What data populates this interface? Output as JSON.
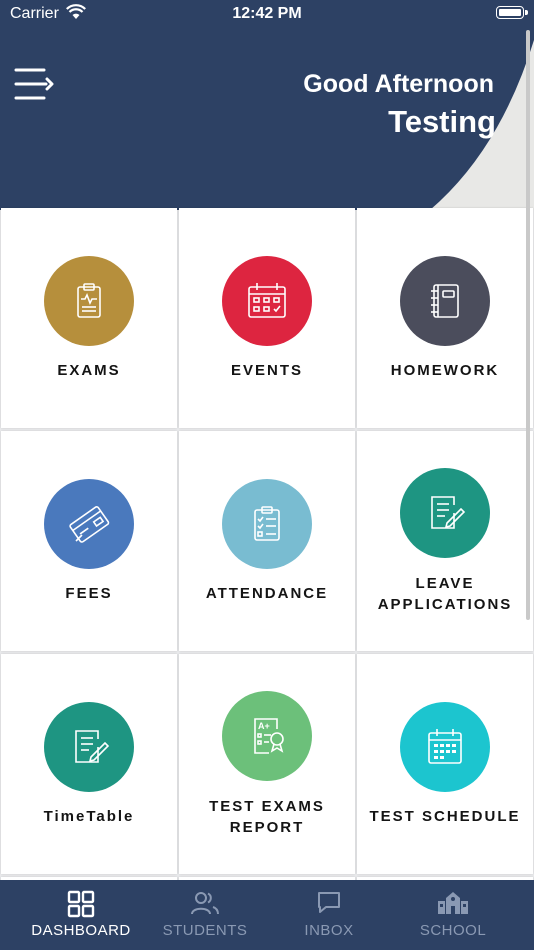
{
  "status_bar": {
    "carrier": "Carrier",
    "time": "12:42 PM"
  },
  "header": {
    "greeting": "Good Afternoon",
    "username": "Testing"
  },
  "tiles": [
    {
      "label": "EXAMS",
      "color": "#b68f3c",
      "icon": "clipboard-icon"
    },
    {
      "label": "EVENTS",
      "color": "#dd2540",
      "icon": "calendar-icon"
    },
    {
      "label": "HOMEWORK",
      "color": "#4b4d5c",
      "icon": "notebook-icon"
    },
    {
      "label": "FEES",
      "color": "#4a79bd",
      "icon": "credit-card-icon"
    },
    {
      "label": "ATTENDANCE",
      "color": "#79bcd1",
      "icon": "checklist-icon"
    },
    {
      "label_line1": "LEAVE",
      "label_line2": "APPLICATIONS",
      "color": "#1e9582",
      "icon": "edit-document-icon"
    },
    {
      "label": "TimeTable",
      "color": "#1e9582",
      "icon": "edit-document-icon"
    },
    {
      "label_line1": "TEST EXAMS",
      "label_line2": "REPORT",
      "color": "#6cc07a",
      "icon": "graded-report-icon"
    },
    {
      "label": "TEST SCHEDULE",
      "color": "#1cc5cf",
      "icon": "calendar-icon"
    }
  ],
  "tabbar": {
    "dashboard": "DASHBOARD",
    "students": "STUDENTS",
    "inbox": "INBOX",
    "school": "SCHOOL",
    "active": "dashboard",
    "active_color": "#ffffff",
    "inactive_color": "#8a99b3"
  }
}
